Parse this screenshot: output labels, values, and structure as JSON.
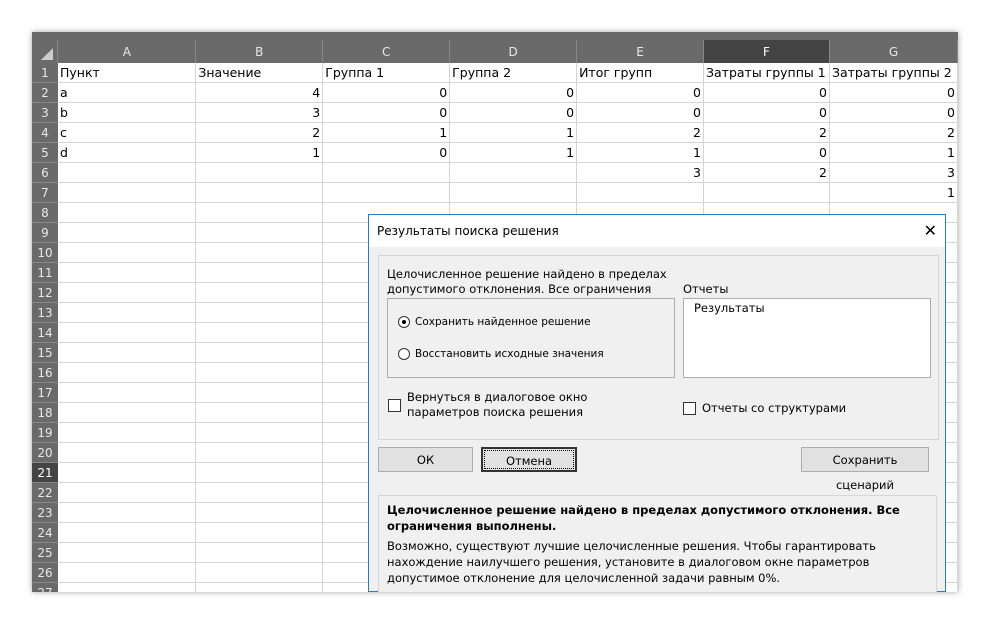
{
  "sheet": {
    "columns": [
      "A",
      "B",
      "C",
      "D",
      "E",
      "F",
      "G"
    ],
    "selected_column": "F",
    "selected_row": 21,
    "rows": [
      [
        "Пункт",
        "Значение",
        "Группа 1",
        "Группа 2",
        "Итог групп",
        "Затраты группы 1",
        "Затраты группы 2"
      ],
      [
        "a",
        "4",
        "0",
        "0",
        "0",
        "0",
        "0"
      ],
      [
        "b",
        "3",
        "0",
        "0",
        "0",
        "0",
        "0"
      ],
      [
        "c",
        "2",
        "1",
        "1",
        "2",
        "2",
        "2"
      ],
      [
        "d",
        "1",
        "0",
        "1",
        "1",
        "0",
        "1"
      ],
      [
        "",
        "",
        "",
        "",
        "3",
        "2",
        "3"
      ],
      [
        "",
        "",
        "",
        "",
        "",
        "",
        "1"
      ]
    ],
    "row_count": 27
  },
  "dialog": {
    "title": "Результаты поиска решения",
    "message": "Целочисленное решение найдено в пределах допустимого отклонения. Все ограничения",
    "options": [
      {
        "label": "Сохранить найденное решение",
        "selected": true
      },
      {
        "label": "Восстановить исходные значения",
        "selected": false
      }
    ],
    "reports_label": "Отчеты",
    "reports": [
      "Результаты"
    ],
    "return_checkbox": {
      "label": "Вернуться в диалоговое окно параметров поиска решения",
      "checked": false
    },
    "outline_checkbox": {
      "label": "Отчеты со структурами",
      "checked": false
    },
    "ok": "ОК",
    "cancel": "Отмена",
    "save_scenario": "Сохранить сценарий",
    "info_bold": "Целочисленное решение найдено в пределах допустимого отклонения. Все ограничения выполнены.",
    "info_text": "Возможно, существуют лучшие целочисленные решения. Чтобы гарантировать нахождение наилучшего решения, установите в диалоговом окне параметров допустимое отклонение для целочисленной задачи равным 0%."
  }
}
